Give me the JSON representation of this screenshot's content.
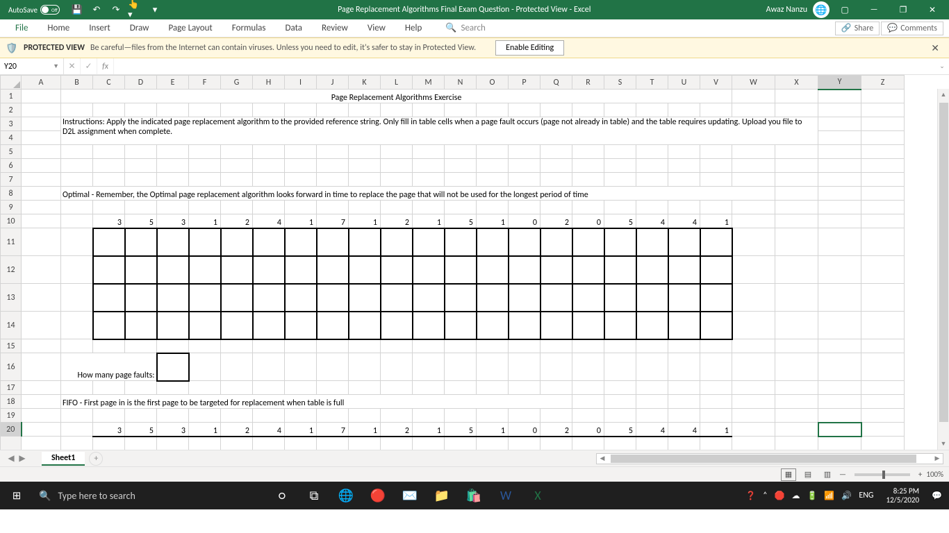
{
  "titlebar": {
    "autosave_label": "AutoSave",
    "autosave_state": "Off",
    "title": "Page Replacement Algorithms Final Exam Question  -  Protected View  -  Excel",
    "username": "Awaz Nanzu"
  },
  "ribbon": {
    "tabs": [
      "File",
      "Home",
      "Insert",
      "Draw",
      "Page Layout",
      "Formulas",
      "Data",
      "Review",
      "View",
      "Help"
    ],
    "search_placeholder": "Search",
    "share": "Share",
    "comments": "Comments"
  },
  "protected_view": {
    "title": "PROTECTED VIEW",
    "message": "Be careful—files from the Internet can contain viruses. Unless you need to edit, it's safer to stay in Protected View.",
    "button": "Enable Editing"
  },
  "formula_bar": {
    "name_box": "Y20",
    "formula": ""
  },
  "columns": [
    "A",
    "B",
    "C",
    "D",
    "E",
    "F",
    "G",
    "H",
    "I",
    "J",
    "K",
    "L",
    "M",
    "N",
    "O",
    "P",
    "Q",
    "R",
    "S",
    "T",
    "U",
    "V",
    "W",
    "X",
    "Y",
    "Z"
  ],
  "content": {
    "title": "Page Replacement Algorithms Exercise",
    "instructions": "Instructions: Apply the indicated page replacement algorithm to the provided reference string. Only fill in table cells when a page fault occurs (page not already in table) and the table requires updating. Upload you file to D2L assignment when complete.",
    "optimal_note": "Optimal - Remember, the Optimal page replacement algorithm looks forward in time to replace the page that will not be used for the longest period of time",
    "fifo_note": "FIFO - First page in is the first page to be targeted for replacement when table is full",
    "page_faults_label": "How many page faults:",
    "ref_string": [
      "3",
      "5",
      "3",
      "1",
      "2",
      "4",
      "1",
      "7",
      "1",
      "2",
      "1",
      "5",
      "1",
      "0",
      "2",
      "0",
      "5",
      "4",
      "4",
      "1"
    ]
  },
  "sheet_tabs": {
    "active": "Sheet1"
  },
  "status_bar": {
    "zoom": "100%"
  },
  "taskbar": {
    "search_placeholder": "Type here to search",
    "time": "8:25 PM",
    "date": "12/5/2020"
  }
}
